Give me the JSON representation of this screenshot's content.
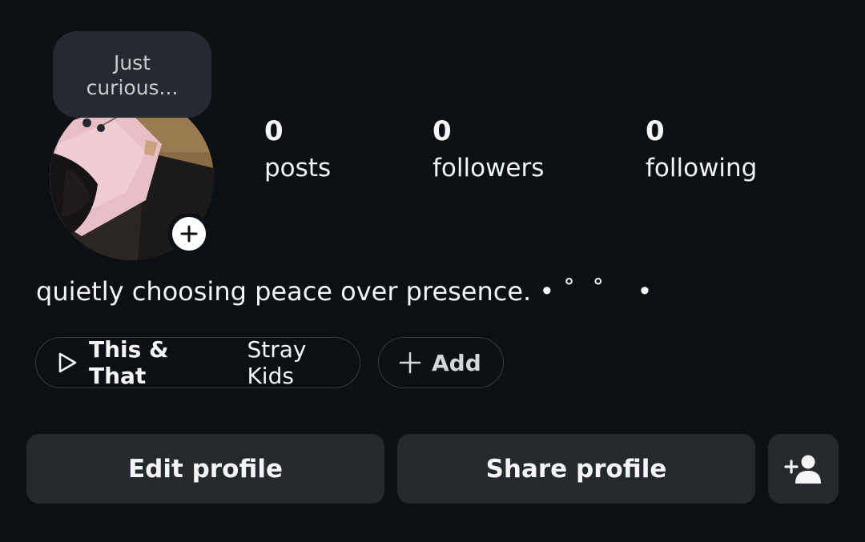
{
  "note": {
    "text_line1": "Just",
    "text_line2": "curious..."
  },
  "avatar": {
    "add_story_icon": "plus-icon"
  },
  "stats": {
    "posts": {
      "count": "0",
      "label": "posts"
    },
    "followers": {
      "count": "0",
      "label": "followers"
    },
    "following": {
      "count": "0",
      "label": "following"
    }
  },
  "bio": {
    "text": "quietly choosing peace over presence. • ˚  ˚    •"
  },
  "music_chip": {
    "icon": "play-icon",
    "title": "This & That",
    "artist": "Stray Kids"
  },
  "add_chip": {
    "icon": "plus-icon",
    "label": "Add"
  },
  "actions": {
    "edit_label": "Edit profile",
    "share_label": "Share profile",
    "suggest_icon": "add-person-icon"
  },
  "colors": {
    "background": "#0c1014",
    "button_bg": "#25292e",
    "note_bg": "#262a30",
    "text": "#f5f5f5"
  }
}
